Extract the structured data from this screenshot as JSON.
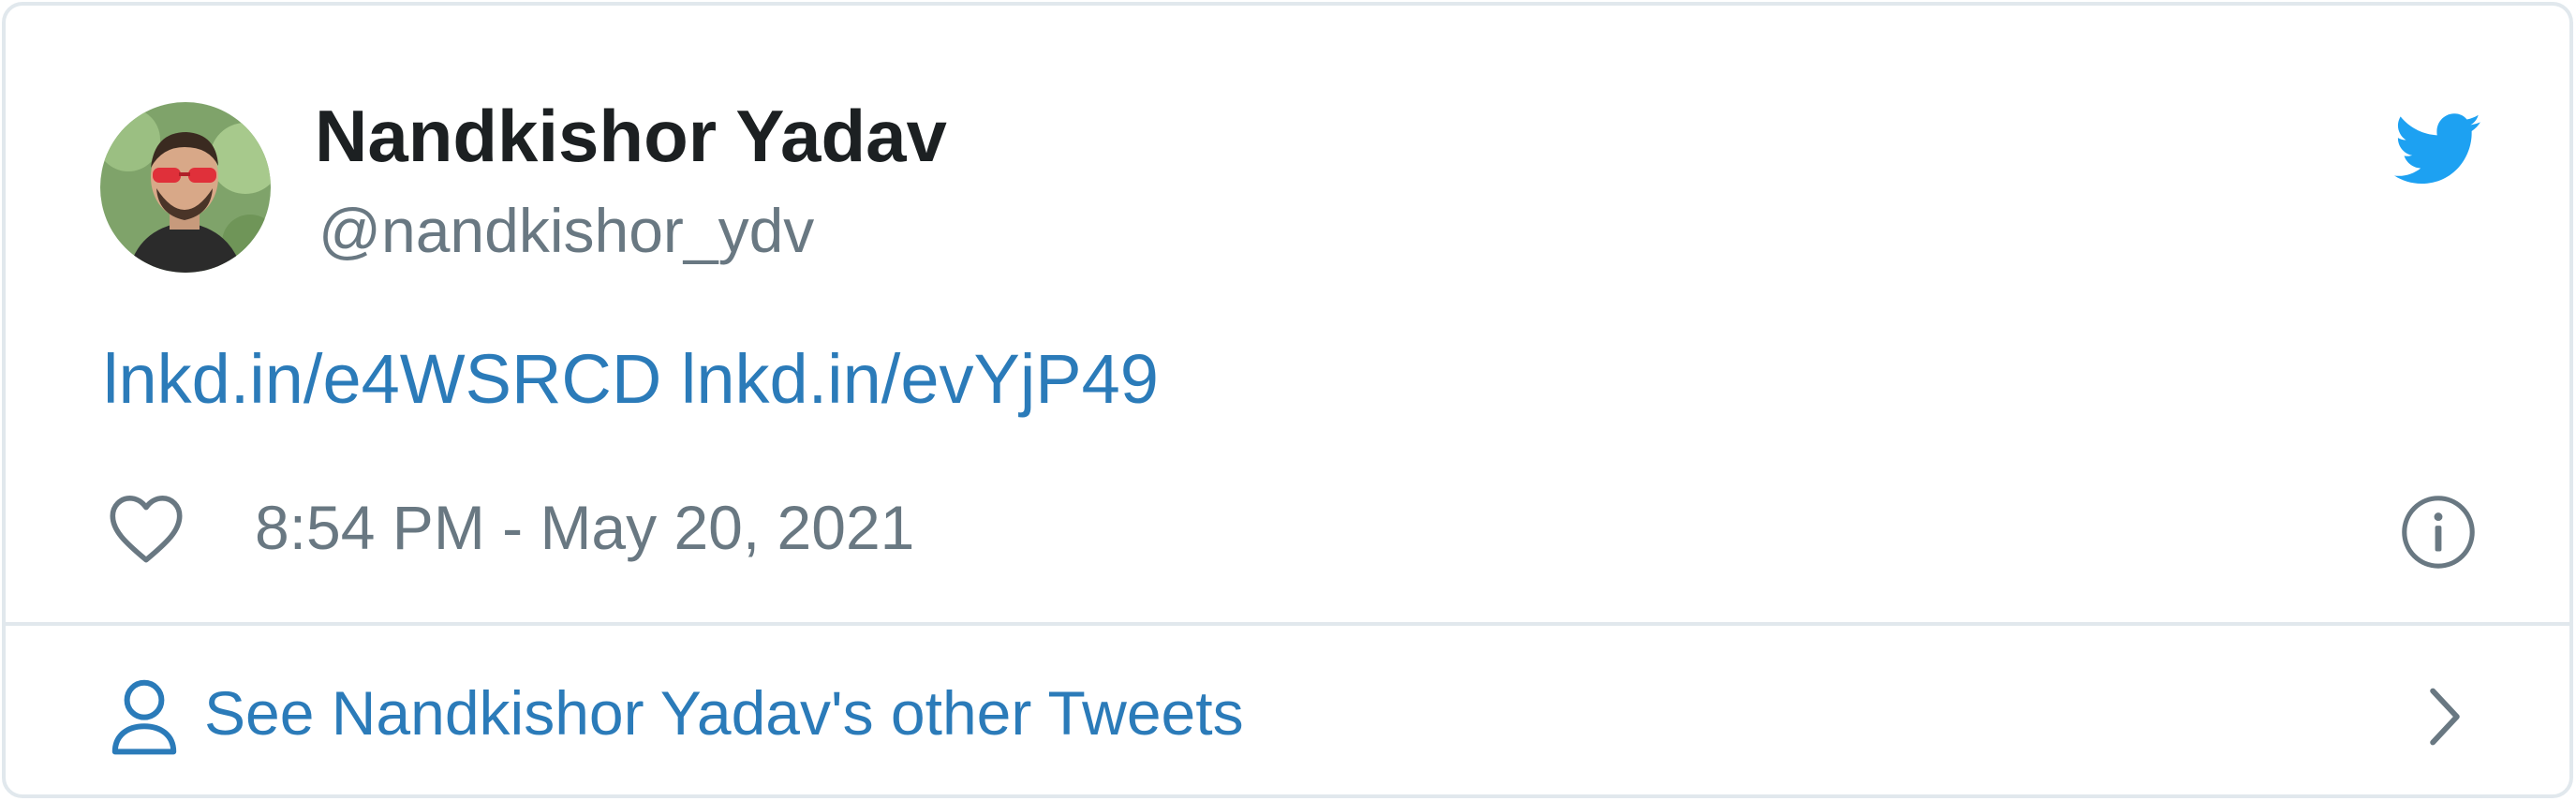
{
  "tweet": {
    "author_name": "Nandkishor Yadav",
    "author_handle": "@nandkishor_ydv",
    "links": [
      "lnkd.in/e4WSRCD",
      "lnkd.in/evYjP49"
    ],
    "link_separator": " ",
    "timestamp": "8:54 PM - May 20, 2021"
  },
  "footer": {
    "label": "See Nandkishor Yadav's other Tweets"
  },
  "icons": {
    "brand": "twitter-bird-icon",
    "like": "heart-icon",
    "info": "info-icon",
    "profile": "person-icon",
    "more": "chevron-right-icon"
  },
  "colors": {
    "twitter_blue": "#1da1f2",
    "link_blue": "#2b7bb9",
    "name_text": "#1c2022",
    "muted_text": "#697882",
    "border": "#e1e8ed"
  }
}
